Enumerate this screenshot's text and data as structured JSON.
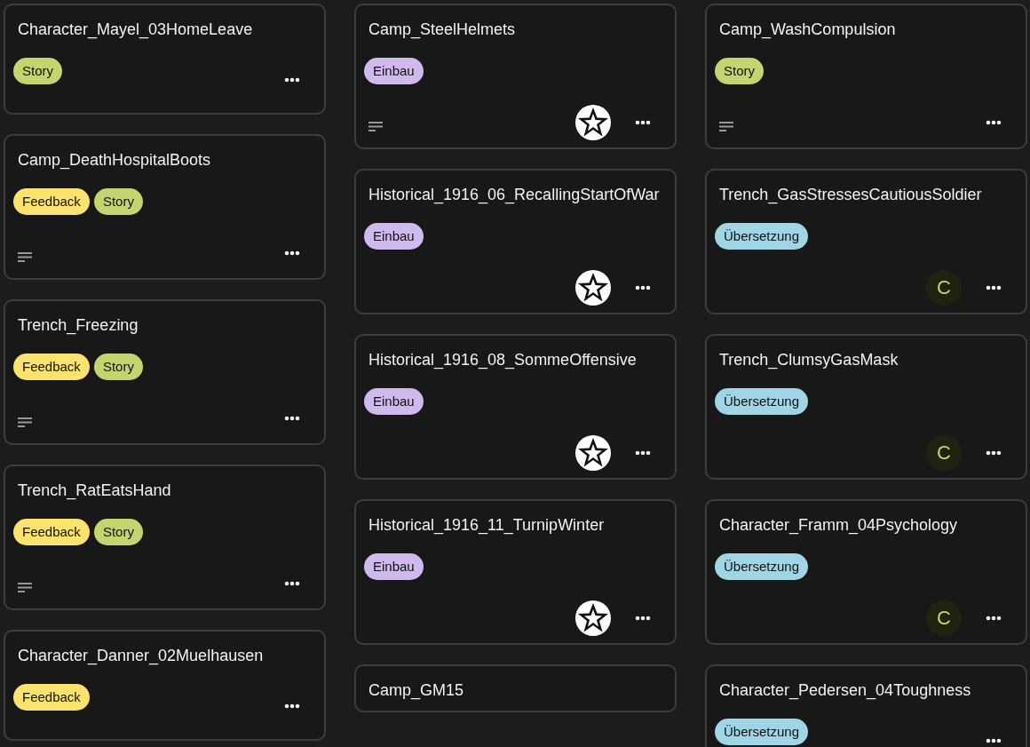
{
  "columns": [
    {
      "cards": [
        {
          "title": "Character_Mayel_03HomeLeave",
          "tags": [
            {
              "label": "Story",
              "color": "#c5d46e"
            }
          ],
          "description": false,
          "avatar": {
            "kind": "none"
          }
        },
        {
          "title": "Camp_DeathHospitalBoots",
          "tags": [
            {
              "label": "Feedback",
              "color": "#fce36d"
            },
            {
              "label": "Story",
              "color": "#c5d46e"
            }
          ],
          "description": true,
          "avatar": {
            "kind": "none"
          }
        },
        {
          "title": "Trench_Freezing",
          "tags": [
            {
              "label": "Feedback",
              "color": "#fce36d"
            },
            {
              "label": "Story",
              "color": "#c5d46e"
            }
          ],
          "description": true,
          "avatar": {
            "kind": "none"
          }
        },
        {
          "title": "Trench_RatEatsHand",
          "tags": [
            {
              "label": "Feedback",
              "color": "#fce36d"
            },
            {
              "label": "Story",
              "color": "#c5d46e"
            }
          ],
          "description": true,
          "avatar": {
            "kind": "none"
          }
        },
        {
          "title": "Character_Danner_02Muelhausen",
          "tags": [
            {
              "label": "Feedback",
              "color": "#fce36d"
            }
          ],
          "description": false,
          "avatar": {
            "kind": "none"
          }
        }
      ]
    },
    {
      "cards": [
        {
          "title": "Camp_SteelHelmets",
          "tags": [
            {
              "label": "Einbau",
              "color": "#d0b9ec"
            }
          ],
          "description": true,
          "avatar": {
            "kind": "emblem"
          }
        },
        {
          "title": "Historical_1916_06_RecallingStartOfWar",
          "tags": [
            {
              "label": "Einbau",
              "color": "#d0b9ec"
            }
          ],
          "description": false,
          "avatar": {
            "kind": "emblem"
          }
        },
        {
          "title": "Historical_1916_08_SommeOffensive",
          "tags": [
            {
              "label": "Einbau",
              "color": "#d0b9ec"
            }
          ],
          "description": false,
          "avatar": {
            "kind": "emblem"
          }
        },
        {
          "title": "Historical_1916_11_TurnipWinter",
          "tags": [
            {
              "label": "Einbau",
              "color": "#d0b9ec"
            }
          ],
          "description": false,
          "avatar": {
            "kind": "emblem"
          }
        },
        {
          "title": "Camp_GM15",
          "description": false,
          "avatar": {
            "kind": "none"
          }
        }
      ]
    },
    {
      "cards": [
        {
          "title": "Camp_WashCompulsion",
          "tags": [
            {
              "label": "Story",
              "color": "#c5d46e"
            }
          ],
          "description": true,
          "avatar": {
            "kind": "none"
          }
        },
        {
          "title": "Trench_GasStressesCautiousSoldier",
          "tags": [
            {
              "label": "Übersetzung",
              "color": "#9fd5e4"
            }
          ],
          "description": false,
          "avatar": {
            "kind": "initial",
            "text": "C"
          }
        },
        {
          "title": "Trench_ClumsyGasMask",
          "tags": [
            {
              "label": "Übersetzung",
              "color": "#9fd5e4"
            }
          ],
          "description": false,
          "avatar": {
            "kind": "initial",
            "text": "C"
          }
        },
        {
          "title": "Character_Framm_04Psychology",
          "tags": [
            {
              "label": "Übersetzung",
              "color": "#9fd5e4"
            }
          ],
          "description": false,
          "avatar": {
            "kind": "initial",
            "text": "C"
          }
        },
        {
          "title": "Character_Pedersen_04Toughness",
          "tags": [
            {
              "label": "Übersetzung",
              "color": "#9fd5e4"
            }
          ],
          "description": false,
          "avatar": {
            "kind": "none"
          }
        }
      ]
    }
  ]
}
